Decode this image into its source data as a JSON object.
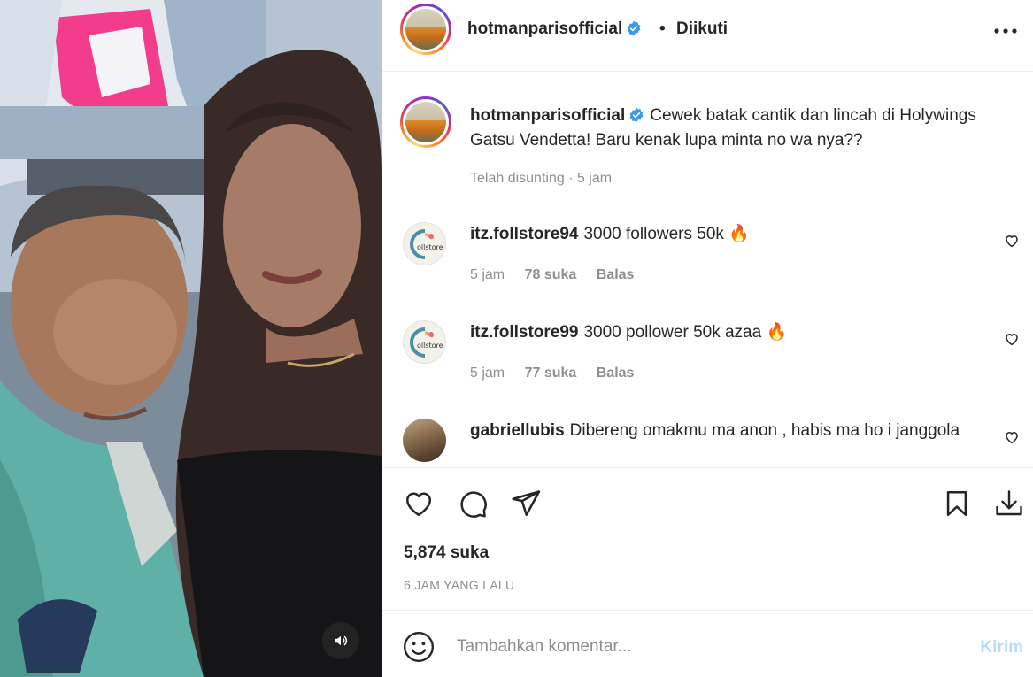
{
  "post": {
    "author": {
      "username": "hotmanparisofficial",
      "verified": true,
      "follow_status": "Diikuti",
      "separator": "•"
    },
    "caption": {
      "username": "hotmanparisofficial",
      "text": "Cewek batak cantik dan lincah di Holywings Gatsu Vendetta! Baru kenak lupa minta no wa nya??",
      "meta": "Telah disunting · 5 jam"
    },
    "comments": [
      {
        "username": "itz.follstore94",
        "text": "3000 followers 50k",
        "emoji": "🔥",
        "time": "5 jam",
        "likes": "78 suka",
        "reply": "Balas",
        "avatar": "follstore"
      },
      {
        "username": "itz.follstore99",
        "text": "3000 pollower 50k azaa",
        "emoji": "🔥",
        "time": "5 jam",
        "likes": "77 suka",
        "reply": "Balas",
        "avatar": "follstore"
      },
      {
        "username": "gabriellubis",
        "text": "Dibereng omakmu ma anon , habis ma ho i janggola",
        "emoji": "",
        "avatar": "photo"
      }
    ],
    "likes": "5,874 suka",
    "posted": "6 JAM YANG LALU",
    "composer": {
      "placeholder": "Tambahkan komentar...",
      "send": "Kirim"
    }
  },
  "icons": {
    "more": "more-horizontal-icon",
    "like": "heart-icon",
    "comment": "comment-bubble-icon",
    "share": "paper-plane-icon",
    "save": "bookmark-icon",
    "download": "download-icon",
    "emoji": "smiley-icon",
    "mute": "speaker-icon",
    "verified": "verified-badge-icon"
  },
  "colors": {
    "verified": "#3897f0",
    "muted_text": "#8e8e8e",
    "send_disabled": "#b2dffc",
    "fire": "#ff6a00"
  }
}
